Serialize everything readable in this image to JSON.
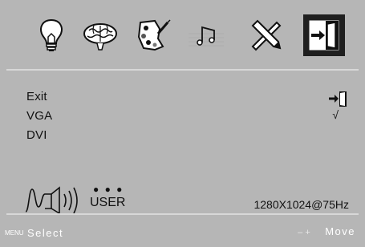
{
  "tabs": [
    {
      "name": "brightness",
      "icon": "lightbulb-icon"
    },
    {
      "name": "image",
      "icon": "brain-icon"
    },
    {
      "name": "color",
      "icon": "palette-icon"
    },
    {
      "name": "audio",
      "icon": "music-icon"
    },
    {
      "name": "tools",
      "icon": "tools-icon"
    },
    {
      "name": "exit",
      "icon": "exit-door-icon",
      "selected": true
    }
  ],
  "menu": {
    "items": [
      "Exit",
      "VGA",
      "DVI"
    ],
    "checkmark": "√"
  },
  "status": {
    "dots": "● ● ●",
    "mode": "USER",
    "resolution": "1280X1024@75Hz"
  },
  "footer": {
    "menu_key": "MENU",
    "select_label": "Select",
    "nav_symbols": "–   +",
    "move_label": "Move"
  },
  "colors": {
    "background": "#b6b6b6",
    "selected_tab": "#1f1f1f",
    "footer_text": "#ffffff"
  }
}
